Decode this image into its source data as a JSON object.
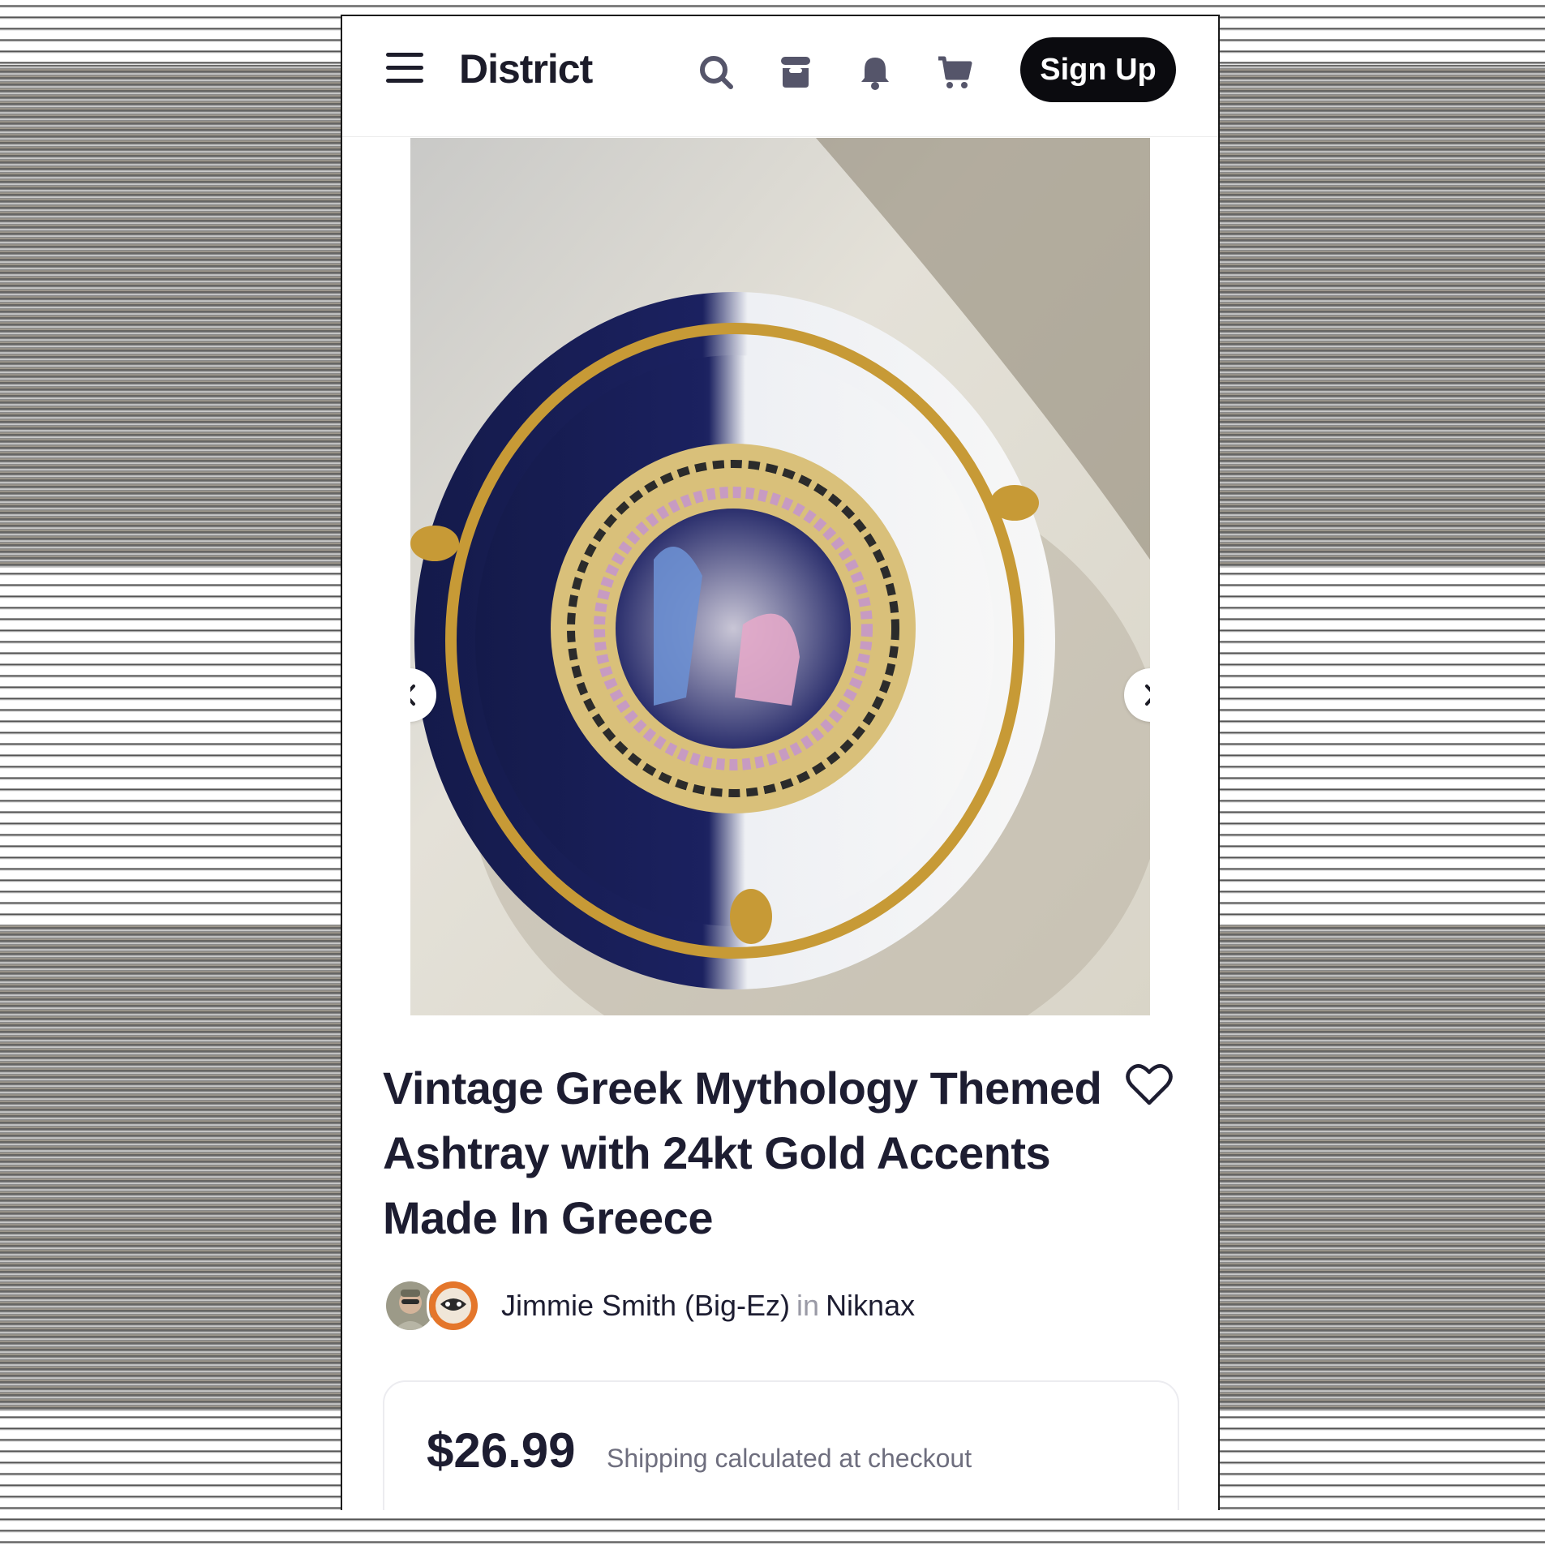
{
  "header": {
    "brand": "District",
    "signup_label": "Sign Up",
    "icons": [
      "menu-icon",
      "search-icon",
      "shop-icon",
      "bell-icon",
      "cart-icon"
    ]
  },
  "gallery": {
    "image_count": 5,
    "active_index": 0,
    "image_alt": "ashtray-photo"
  },
  "product": {
    "title": "Vintage Greek Mythology Themed Ashtray with 24kt Gold Accents Made In Greece",
    "seller": "Jimmie Smith (Big-Ez)",
    "in_word": "in",
    "shop": "Niknax",
    "price": "$26.99",
    "shipping_note": "Shipping calculated at checkout"
  },
  "colors": {
    "text_dark": "#1d1d31",
    "button_bg": "#0b0b0f",
    "muted": "#6e6e7e"
  }
}
